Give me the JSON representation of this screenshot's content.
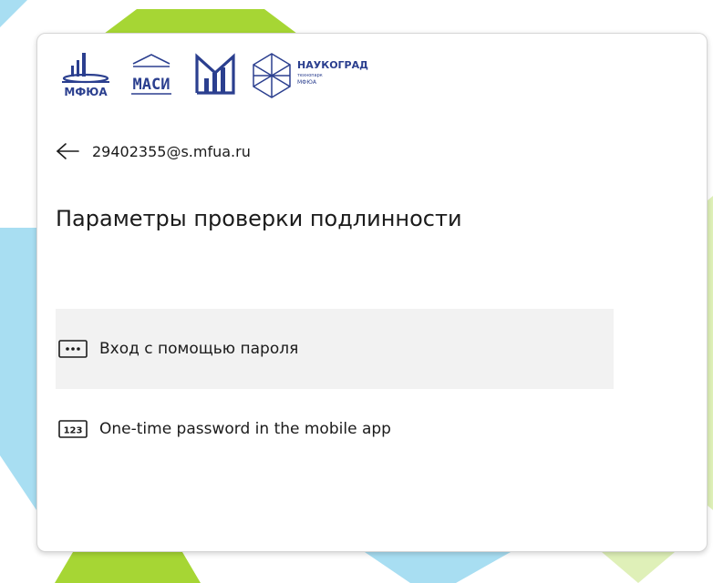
{
  "logos": {
    "mfua_text": "МФЮА",
    "masi_text": "МАСИ",
    "naukograd_title": "НАУКОГРАД",
    "naukograd_sub1": "технопарк",
    "naukograd_sub2": "МФЮА"
  },
  "header": {
    "back_icon": "back-arrow-icon",
    "email": "29402355@s.mfua.ru"
  },
  "title": "Параметры проверки подлинности",
  "options": [
    {
      "icon": "password-dots-icon",
      "icon_text": "•••",
      "label": "Вход с помощью пароля",
      "selected": true
    },
    {
      "icon": "otp-123-icon",
      "icon_text": "123",
      "label": "One-time password in the mobile app",
      "selected": false
    }
  ],
  "colors": {
    "logo_blue": "#2b3f8f",
    "accent_green": "#a6d634",
    "accent_cyan": "#a8def2",
    "text": "#1b1b1b",
    "selected_bg": "#f2f2f2"
  }
}
